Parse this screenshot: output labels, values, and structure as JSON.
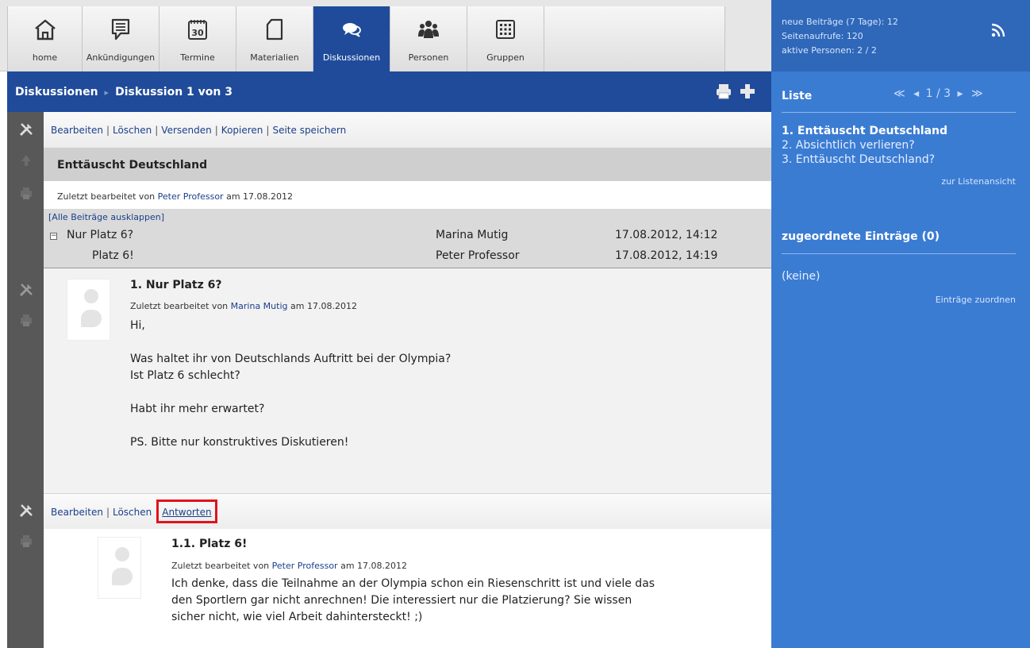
{
  "nav": {
    "tabs": [
      {
        "label": "home",
        "icon": "home-icon"
      },
      {
        "label": "Ankündigungen",
        "icon": "announcement-icon"
      },
      {
        "label": "Termine",
        "icon": "calendar-icon"
      },
      {
        "label": "Materialien",
        "icon": "document-icon"
      },
      {
        "label": "Diskussionen",
        "icon": "discussion-icon",
        "active": true
      },
      {
        "label": "Personen",
        "icon": "people-icon"
      },
      {
        "label": "Gruppen",
        "icon": "groups-icon"
      }
    ],
    "calendar_day": "30"
  },
  "breadcrumb": {
    "section": "Diskussionen",
    "current": "Diskussion 1 von 3"
  },
  "discussion": {
    "actions": [
      "Bearbeiten",
      "Löschen",
      "Versenden",
      "Kopieren",
      "Seite speichern"
    ],
    "title": "Enttäuscht Deutschland",
    "edited_prefix": "Zuletzt bearbeitet von",
    "edited_by": "Peter Professor",
    "edited_on_prefix": "am",
    "edited_date": "17.08.2012",
    "expand_all": "[Alle Beiträge ausklappen]",
    "tree_expander": "−",
    "tree": [
      {
        "title": "Nur Platz 6?",
        "author": "Marina Mutig",
        "date": "17.08.2012, 14:12"
      },
      {
        "title": "Platz 6!",
        "author": "Peter Professor",
        "date": "17.08.2012, 14:19"
      }
    ]
  },
  "posts": [
    {
      "title": "1. Nur Platz 6?",
      "edited_prefix": "Zuletzt bearbeitet von",
      "author": "Marina Mutig",
      "on": "am",
      "date": "17.08.2012",
      "paragraphs": [
        "Hi,",
        "Was haltet ihr von Deutschlands Auftritt bei der Olympia?",
        "Ist Platz 6 schlecht?",
        "Habt ihr mehr erwartet?",
        "PS. Bitte nur konstruktives Diskutieren!"
      ],
      "actions": [
        "Bearbeiten",
        "Löschen",
        "Antworten"
      ]
    },
    {
      "title": "1.1. Platz 6!",
      "edited_prefix": "Zuletzt bearbeitet von",
      "author": "Peter Professor",
      "on": "am",
      "date": "17.08.2012",
      "paragraphs": [
        "Ich denke, dass die Teilnahme an der Olympia schon ein Riesenschritt ist und viele das",
        "den Sportlern gar nicht anrechnen! Die interessiert nur die Platzierung? Sie wissen",
        "sicher nicht, wie viel Arbeit dahintersteckt! ;)"
      ]
    }
  ],
  "sidebar": {
    "stats": [
      "neue Beiträge (7 Tage): 12",
      "Seitenaufrufe: 120",
      "aktive Personen: 2 / 2"
    ],
    "list_heading": "Liste",
    "pager": {
      "first": "≪",
      "prev": "◂",
      "page": "1 / 3",
      "next": "▸",
      "last": "≫"
    },
    "items": [
      "1. Enttäuscht Deutschland",
      "2. Absichtlich verlieren?",
      "3. Enttäuscht Deutschland?"
    ],
    "list_view_link": "zur Listenansicht",
    "assigned_heading": "zugeordnete Einträge (0)",
    "assigned_empty": "(keine)",
    "assign_link": "Einträge zuordnen"
  },
  "colors": {
    "header_blue": "#1f4b9a",
    "sidebar_blue": "#3b7cd3",
    "highlight_red": "#e0141c"
  }
}
